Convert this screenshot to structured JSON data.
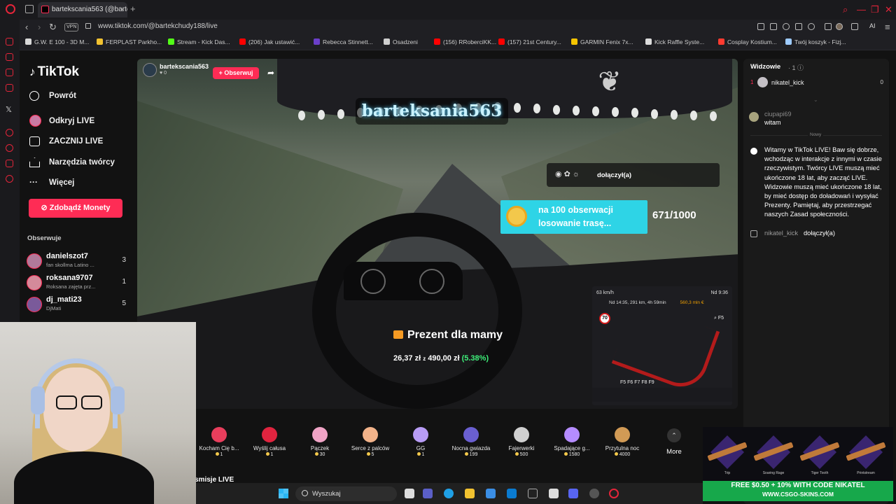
{
  "browser": {
    "tab_title": "bartekscania563 (@bartek",
    "url": "www.tiktok.com/@bartekchudy188/live",
    "vpn_label": "VPN",
    "ai_label": "AI",
    "bookmarks": [
      {
        "label": "G.W. E 100 - 3D M...",
        "color": "#d9d9d9"
      },
      {
        "label": "FERPLAST Parkho...",
        "color": "#f2c230"
      },
      {
        "label": "Stream - Kick Das...",
        "color": "#53fc18"
      },
      {
        "label": "(206) Jak ustawić...",
        "color": "#ff0000"
      },
      {
        "label": "Rebecca Stinnett...",
        "color": "#6b3fc9"
      },
      {
        "label": "Osadzeni",
        "color": "#cfcfcf"
      },
      {
        "label": "(156) RRoberciKK...",
        "color": "#ff0000"
      },
      {
        "label": "(157) 21st Century...",
        "color": "#ff0000"
      },
      {
        "label": "GARMIN Fenix 7x...",
        "color": "#f5c400"
      },
      {
        "label": "Kick Raffle Syste...",
        "color": "#dcdcdc"
      },
      {
        "label": "Cosplay Kostium...",
        "color": "#ff3b30"
      },
      {
        "label": "Twój koszyk - Fizj...",
        "color": "#9ecbff"
      }
    ]
  },
  "sidebar": {
    "logo": "TikTok",
    "items": [
      {
        "label": "Powrót"
      },
      {
        "label": "Odkryj LIVE"
      },
      {
        "label": "ZACZNIJ LIVE"
      },
      {
        "label": "Narzędzia twórcy"
      },
      {
        "label": "Więcej"
      }
    ],
    "coins_button": "Zdobądź Monety",
    "following_title": "Obserwuje",
    "following": [
      {
        "name": "danielszot7",
        "sub": "fan skollma Latino ...",
        "count": "3"
      },
      {
        "name": "roksana9707",
        "sub": "Roksana zajęta prz...",
        "count": "1"
      },
      {
        "name": "dj_mati23",
        "sub": "DjMati",
        "count": "5"
      }
    ]
  },
  "stream": {
    "host_name": "bartekscania563",
    "likes": "0",
    "follow_label": "+ Obserwuj",
    "overlay_name": "barteksania563",
    "join_text": "dołączył(a)",
    "goal_text": "na 100 obserwacji losowanie trasę...",
    "goal_count": "671/1000",
    "gift_title": "Prezent dla mamy",
    "gift_current": "26,37 zł",
    "gift_of": "z",
    "gift_target": "490,00 zł",
    "gift_pct": "(5.38%)",
    "minimap": {
      "speed": "63 km/h",
      "time": "Nd 9:36",
      "eta": "Nd 14:35, 291 km, 4h 59min",
      "money": "560,3 mln €",
      "limit": "70",
      "f5_label": "F5",
      "keys": "F5   F6   F7   F8   F9"
    }
  },
  "gifts": [
    {
      "name": "Kocham Cię b...",
      "price": "1",
      "color": "#e83e5c"
    },
    {
      "name": "Wyślij całusa",
      "price": "1",
      "color": "#e0243f"
    },
    {
      "name": "Pączek",
      "price": "30",
      "color": "#f0a4c6"
    },
    {
      "name": "Serce z palców",
      "price": "5",
      "color": "#f2b38a"
    },
    {
      "name": "GG",
      "price": "1",
      "color": "#b89cf5"
    },
    {
      "name": "Nocna gwiazda",
      "price": "199",
      "color": "#6a5fd1"
    },
    {
      "name": "Fajerwerki",
      "price": "500",
      "color": "#cfcfcf"
    },
    {
      "name": "Spadające g...",
      "price": "1580",
      "color": "#b58cff"
    },
    {
      "name": "Przytulna noc",
      "price": "4000",
      "color": "#d19a55"
    }
  ],
  "more_label": "More",
  "live_sub": "smisje LIVE",
  "chat": {
    "viewers_title": "Widzowie",
    "viewers_count": "· 1",
    "top_viewer": {
      "rank": "1",
      "name": "nikatel_kick",
      "score": "0"
    },
    "message1": {
      "user": "ciupapi69",
      "text": "witam"
    },
    "new_label": "Nowy",
    "system_message": "Witamy w TikTok LIVE! Baw się dobrze, wchodząc w interakcje z innymi w czasie rzeczywistym. Twórcy LIVE muszą mieć ukończone 18 lat, aby zacząć LIVE. Widzowie muszą mieć ukończone 18 lat, by mieć dostęp do doładowań i wysyłać Prezenty. Pamiętaj, aby przestrzegać naszych Zasad społeczności.",
    "join_user": "nikatel_kick",
    "join_text": "dołączył(a)"
  },
  "ad": {
    "items": [
      "Trip",
      "Soaring Rage",
      "Tiger Tooth",
      "Printstream"
    ],
    "line1": "FREE $0.50 + 10% WITH CODE NIKATEL",
    "line2": "WWW.CSGO-SKINS.COM"
  },
  "taskbar": {
    "search_placeholder": "Wyszukaj"
  }
}
